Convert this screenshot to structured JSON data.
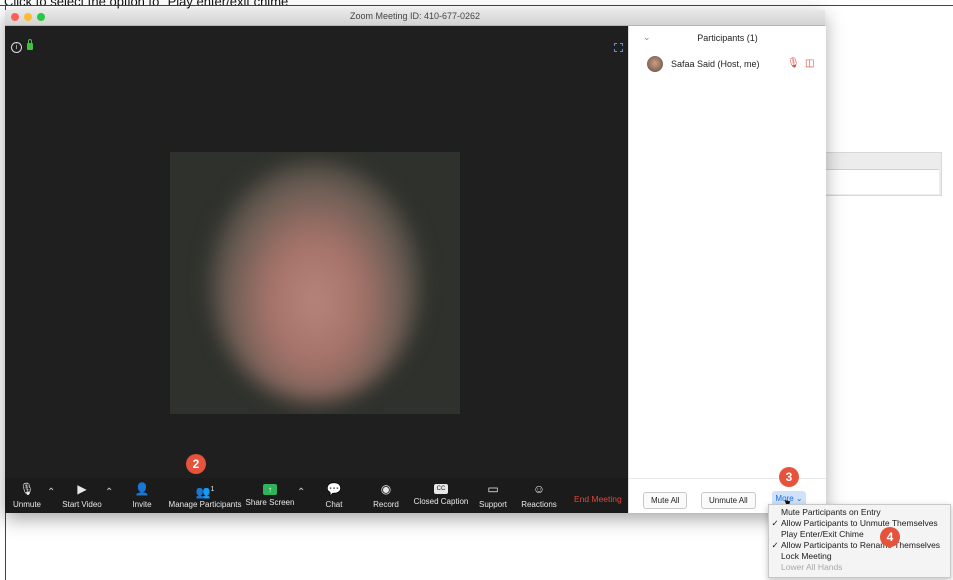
{
  "instruction": "Click to select the option to \"Play enter/exit chime\"",
  "window": {
    "title": "Zoom Meeting ID: 410-677-0262"
  },
  "traffic_lights": [
    "#fc5f57",
    "#fdbc2e",
    "#28c840"
  ],
  "toolbar": {
    "unmute": "Unmute",
    "start_video": "Start Video",
    "invite": "Invite",
    "manage_participants": "Manage Participants",
    "participant_count": "1",
    "share_screen": "Share Screen",
    "chat": "Chat",
    "record": "Record",
    "closed_caption": "Closed Caption",
    "cc_badge": "CC",
    "support": "Support",
    "reactions": "Reactions",
    "end_meeting": "End Meeting"
  },
  "panel": {
    "title": "Participants (1)",
    "participant": {
      "name": "Safaa Said (Host, me)"
    },
    "mute_all": "Mute All",
    "unmute_all": "Unmute All",
    "more": "More ⌄"
  },
  "menu": {
    "items": [
      {
        "label": "Mute Participants on Entry",
        "checked": ""
      },
      {
        "label": "Allow Participants to Unmute Themselves",
        "checked": "✓"
      },
      {
        "label": "Play Enter/Exit Chime",
        "checked": ""
      },
      {
        "label": "Allow Participants to Rename Themselves",
        "checked": "✓"
      },
      {
        "label": "Lock Meeting",
        "checked": ""
      },
      {
        "label": "Lower All Hands",
        "checked": ""
      }
    ]
  },
  "steps": {
    "two": "2",
    "three": "3",
    "four": "4"
  },
  "colors": {
    "accent_red": "#e0463d",
    "step_badge": "#e5533c",
    "share_green": "#2fb25b"
  }
}
